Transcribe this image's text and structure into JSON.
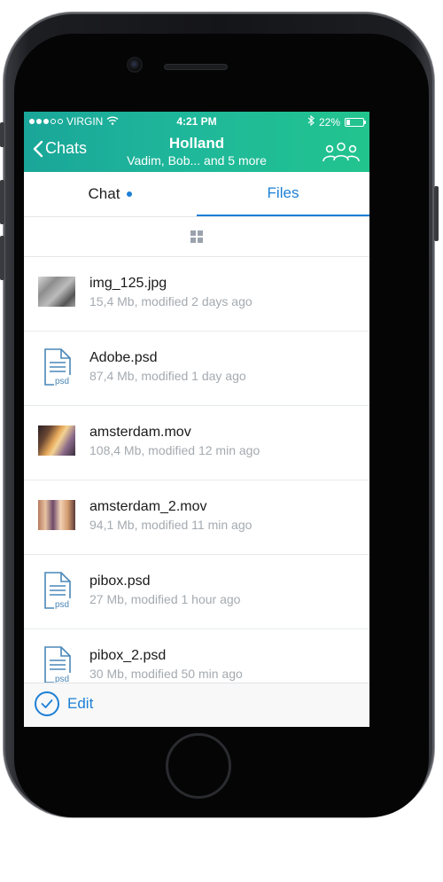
{
  "status_bar": {
    "carrier": "VIRGIN",
    "time": "4:21 PM",
    "battery": "22%",
    "battery_level": 0.22,
    "signal_bars_filled": 3,
    "signal_bars_total": 5
  },
  "nav": {
    "back_label": "Chats",
    "title": "Holland",
    "subtitle": "Vadim, Bob... and 5 more",
    "accent_colors": [
      "#1aa699",
      "#22c48e"
    ]
  },
  "tabs": [
    {
      "label": "Chat",
      "active": false,
      "has_unread": true
    },
    {
      "label": "Files",
      "active": true
    }
  ],
  "view_toggle_icon": "grid-view-icon",
  "files": [
    {
      "name": "img_125.jpg",
      "meta": "15,4 Mb, modified 2 days ago",
      "thumb": "photo"
    },
    {
      "name": "Adobe.psd",
      "meta": "87,4 Mb, modified 1 day ago",
      "thumb": "psd",
      "ext": "psd"
    },
    {
      "name": "amsterdam.mov",
      "meta": "108,4 Mb, modified 12 min ago",
      "thumb": "video"
    },
    {
      "name": "amsterdam_2.mov",
      "meta": "94,1 Mb, modified 11 min ago",
      "thumb": "video"
    },
    {
      "name": "pibox.psd",
      "meta": "27 Mb, modified 1 hour ago",
      "thumb": "psd",
      "ext": "psd"
    },
    {
      "name": "pibox_2.psd",
      "meta": "30 Mb, modified 50 min ago",
      "thumb": "psd",
      "ext": "psd"
    }
  ],
  "bottom_bar": {
    "edit_label": "Edit"
  },
  "colors": {
    "accent_blue": "#1d7fd6",
    "meta_gray": "#a4aab0"
  }
}
